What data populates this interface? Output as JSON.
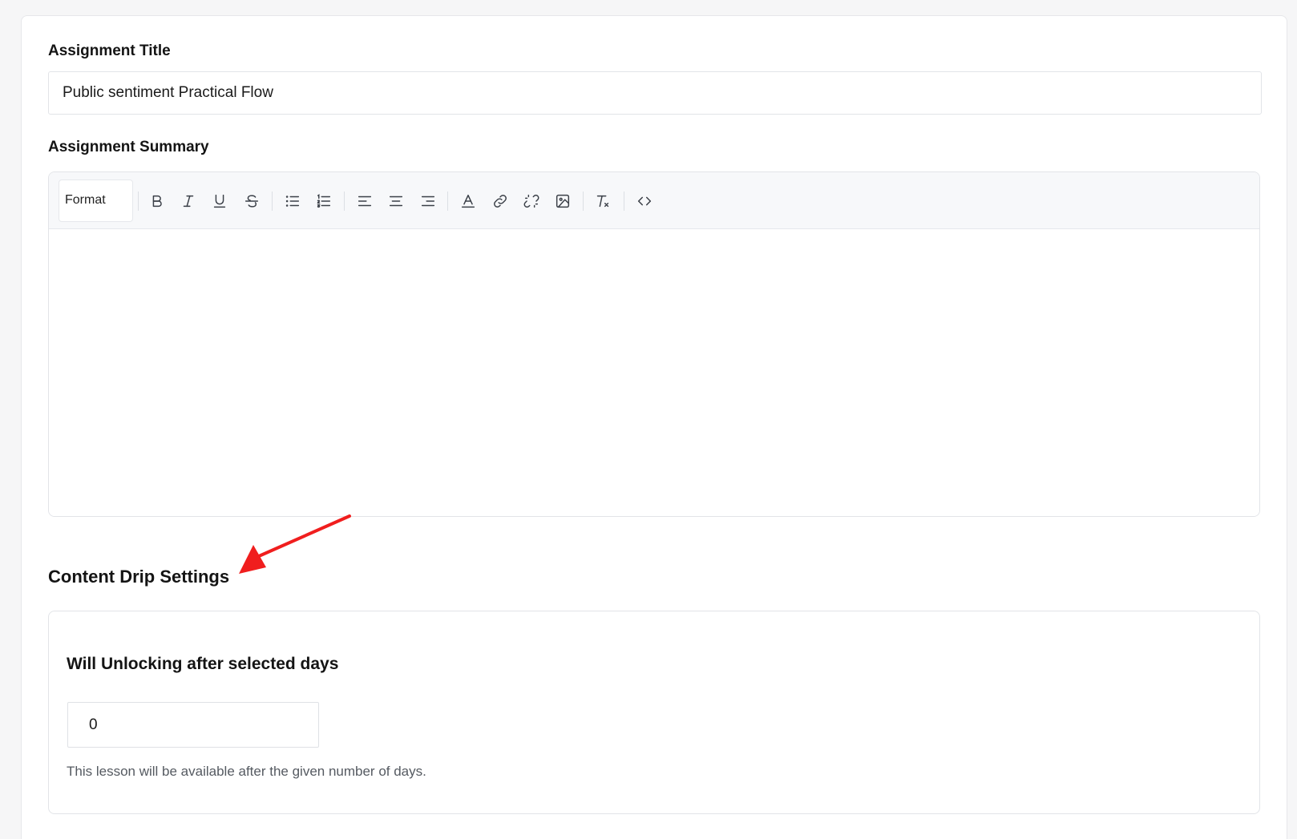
{
  "form": {
    "title_label": "Assignment Title",
    "title_value": "Public sentiment Practical Flow",
    "summary_label": "Assignment Summary"
  },
  "editor": {
    "format_label": "Format",
    "toolbar_icons": [
      "bold-icon",
      "italic-icon",
      "underline-icon",
      "strikethrough-icon",
      "bullet-list-icon",
      "numbered-list-icon",
      "align-left-icon",
      "align-center-icon",
      "align-right-icon",
      "text-color-icon",
      "link-icon",
      "unlink-icon",
      "image-icon",
      "clear-format-icon",
      "code-icon"
    ],
    "content": ""
  },
  "drip": {
    "heading": "Content Drip Settings",
    "title": "Will Unlocking after selected days",
    "days_value": "0",
    "help_text": "This lesson will be available after the given number of days."
  },
  "colors": {
    "annotation_arrow": "#f01e1e",
    "icon": "#3a3f47",
    "page_background": "#f6f6f7"
  }
}
